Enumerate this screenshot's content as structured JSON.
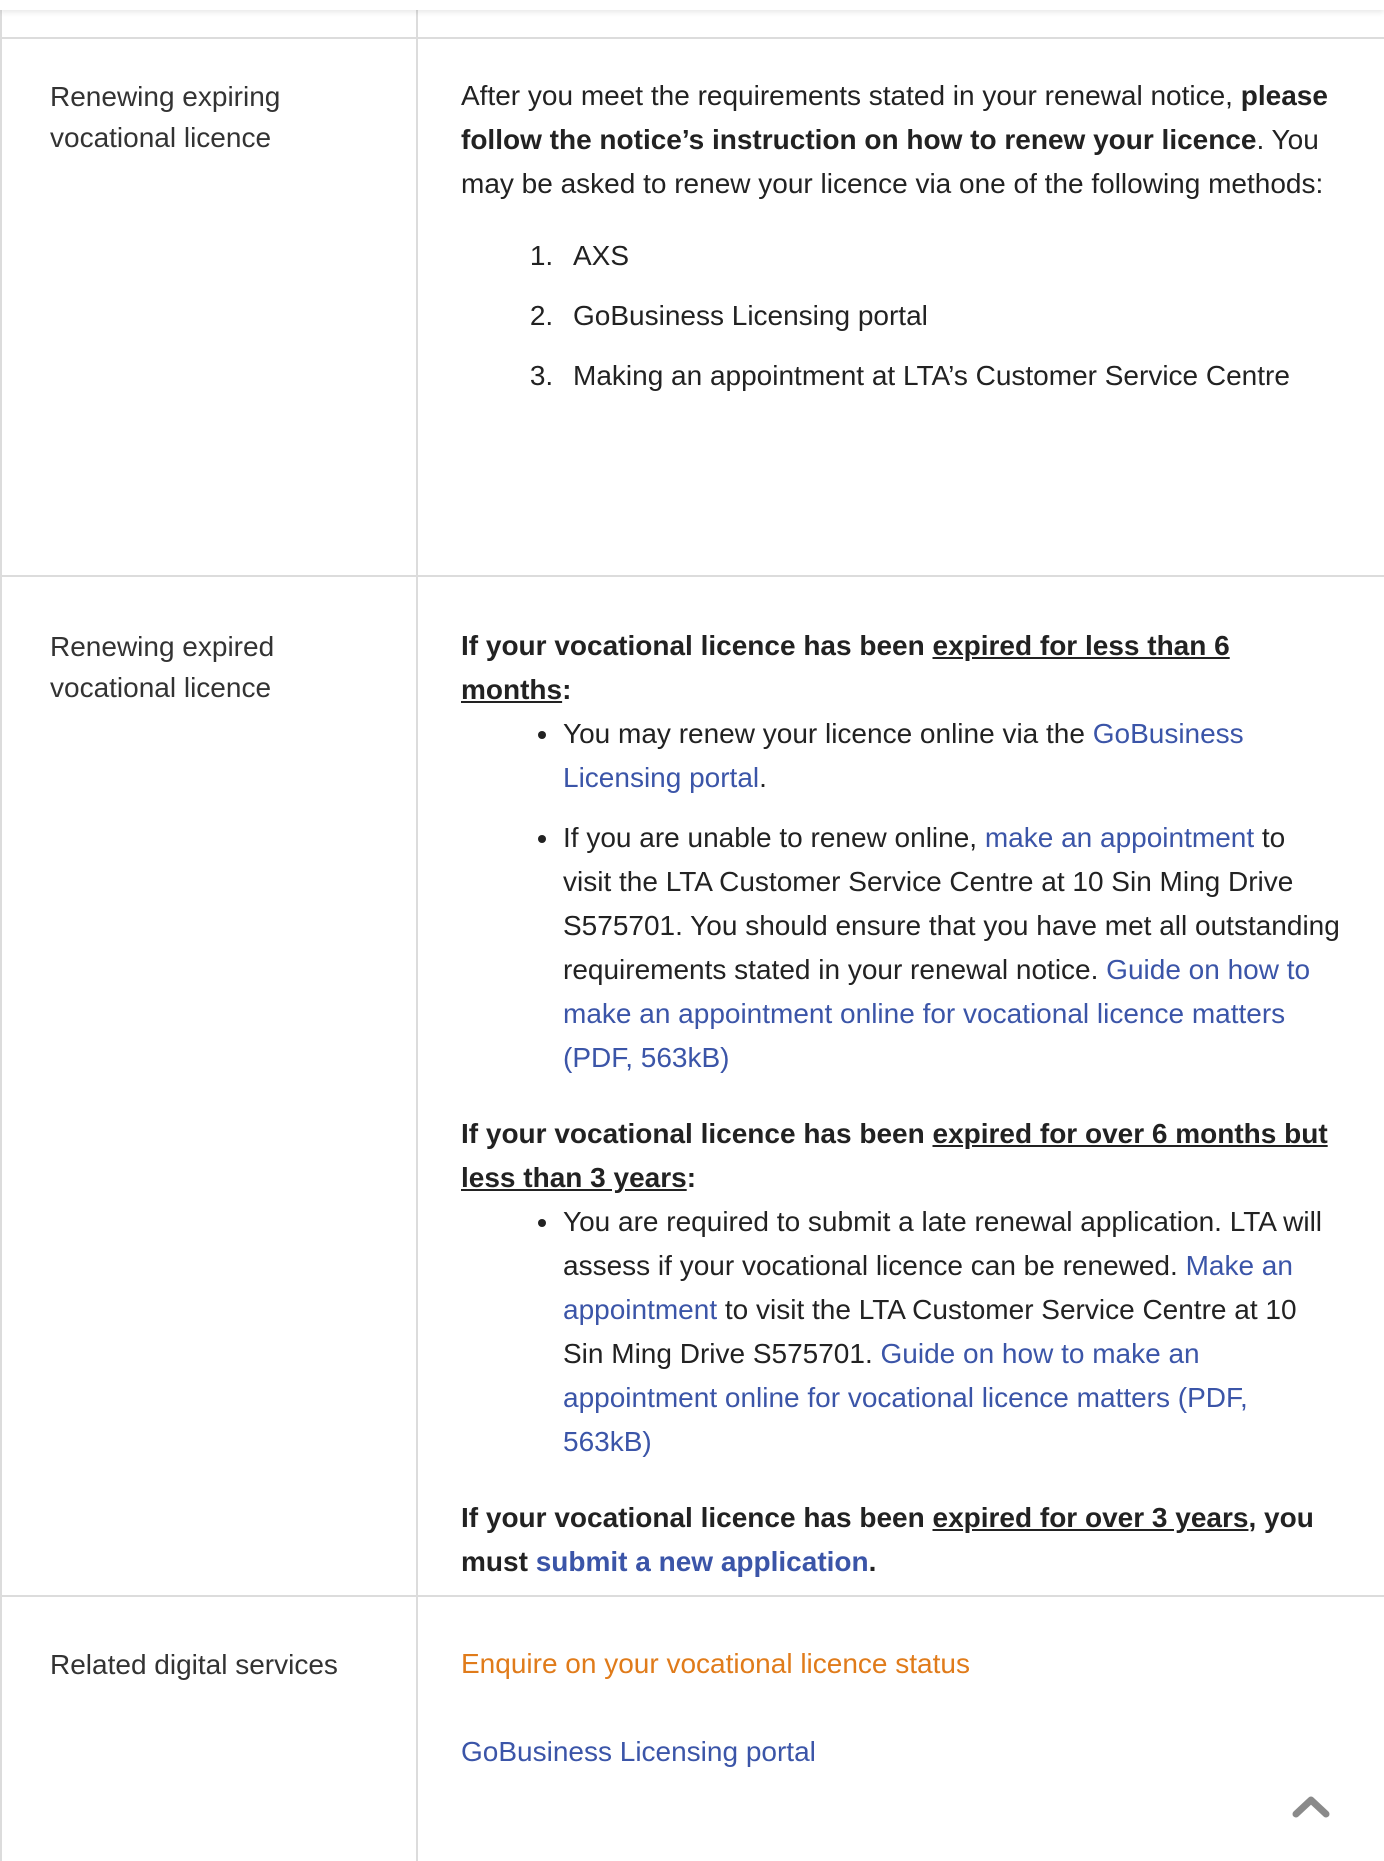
{
  "rows": [
    {
      "label": "Renewing expiring vocational licence",
      "intro_text_1": "After you meet the requirements stated in your renewal notice, ",
      "intro_bold": "please follow the notice’s instruction on how to renew your licence",
      "intro_text_2": ". You may be asked to renew your licence via one of the following methods:",
      "methods": [
        "AXS",
        "GoBusiness Licensing portal",
        "Making an appointment at LTA’s Customer Service Centre"
      ]
    },
    {
      "label": "Renewing expired vocational licence",
      "section1": {
        "lead": "If your vocational licence has been ",
        "underline": "expired for less than 6 months",
        "tail": ":",
        "bullet1_text": "You may renew your licence online via the ",
        "bullet1_link": "GoBusiness Licensing portal",
        "bullet1_end": ".",
        "bullet2_text": "If you are unable to renew online, ",
        "bullet2_link": "make an appointment",
        "bullet2_text2": " to visit the LTA Customer Service Centre at 10 Sin Ming Drive S575701.  You should ensure that you have met all outstanding requirements stated in your renewal notice. ",
        "bullet2_link2": "Guide on how to make an appointment online for vocational licence matters (PDF, 563kB)"
      },
      "section2": {
        "lead": "If your vocational licence has been ",
        "underline": "expired for over 6 months but less than 3 years",
        "tail": ":",
        "bullet1_text": "You are required to submit a late renewal application. LTA will assess if your vocational licence can be renewed. ",
        "bullet1_link": "Make an appointment",
        "bullet1_text2": " to visit the LTA Customer Service Centre at 10 Sin Ming Drive S575701. ",
        "bullet1_link2": "Guide on how to make an appointment online for vocational licence matters (PDF, 563kB)"
      },
      "section3": {
        "lead": "If your vocational licence has been ",
        "underline": "expired for over 3 years",
        "mid": ", you must ",
        "link": "submit a new application",
        "end": "."
      }
    },
    {
      "label": "Related digital services",
      "service1": "Enquire on your vocational licence status",
      "service2": "GoBusiness Licensing portal"
    }
  ],
  "colors": {
    "link": "#3b55a8",
    "accent_link": "#e07b1a",
    "border": "#dcdcdc"
  },
  "icons": {
    "scroll_top": "chevron-up-icon"
  }
}
